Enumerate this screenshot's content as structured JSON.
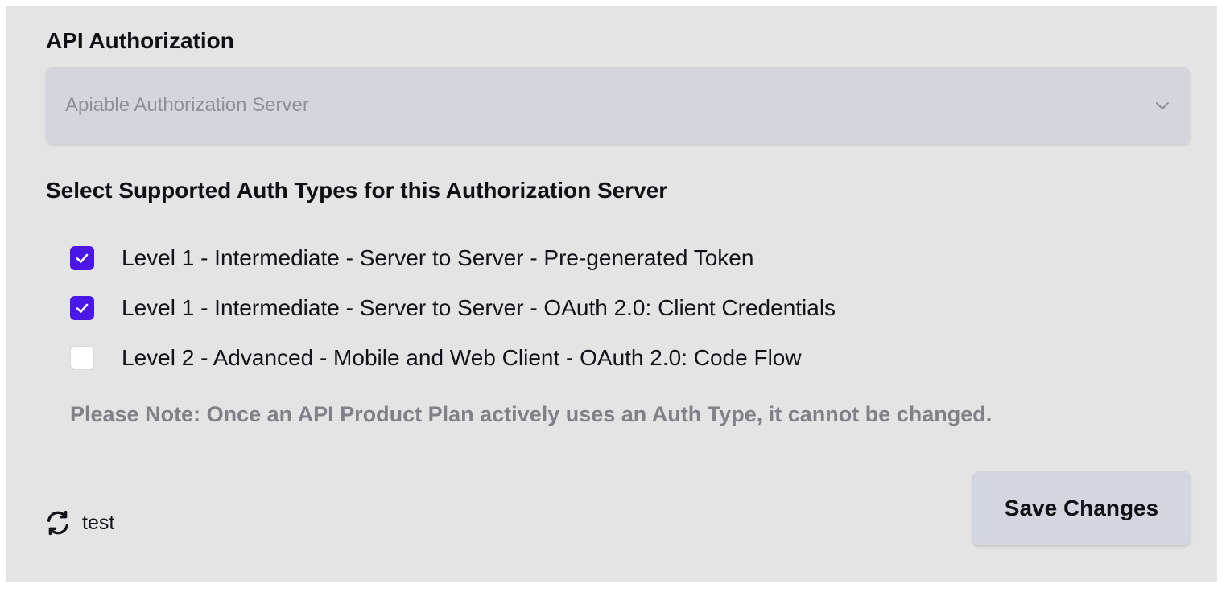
{
  "section_title": "API Authorization",
  "auth_server_select": {
    "selected_value": "Apiable Authorization Server",
    "icon": "chevron-down-icon"
  },
  "auth_types_title": "Select Supported Auth Types for this Authorization Server",
  "auth_types": [
    {
      "label": "Level 1 - Intermediate - Server to Server - Pre-generated Token",
      "checked": true
    },
    {
      "label": "Level 1 - Intermediate - Server to Server - OAuth 2.0: Client Credentials",
      "checked": true
    },
    {
      "label": "Level 2 - Advanced - Mobile and Web Client - OAuth 2.0: Code Flow",
      "checked": false
    }
  ],
  "note": "Please Note: Once an API Product Plan actively uses an Auth Type, it cannot be changed.",
  "refresh": {
    "icon": "refresh-icon",
    "label": "test"
  },
  "save_button_label": "Save Changes",
  "colors": {
    "panel_background": "#e4e4e5",
    "checkbox_checked": "#4a17e6",
    "select_background": "#d4d6dc",
    "button_background": "#d3d6de",
    "note_text": "#7f8187"
  }
}
